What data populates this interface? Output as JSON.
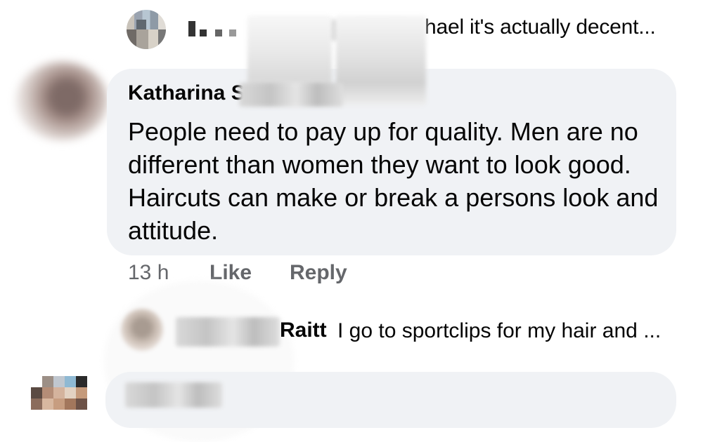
{
  "top_reply": {
    "preview_text": "hael it's actually decent..."
  },
  "comment": {
    "author_visible": "Katharina S",
    "body": "People need to pay up for quality. Men are no different than women they want to look good. Haircuts can make or break a persons look and attitude.",
    "time": "13 h",
    "like_label": "Like",
    "reply_label": "Reply"
  },
  "second_reply": {
    "author_visible": "Raitt",
    "preview_text": "I go to sportclips for my hair and ..."
  },
  "colors": {
    "bubble_bg": "#f0f2f5",
    "secondary_text": "#65676b",
    "primary_text": "#050505"
  }
}
